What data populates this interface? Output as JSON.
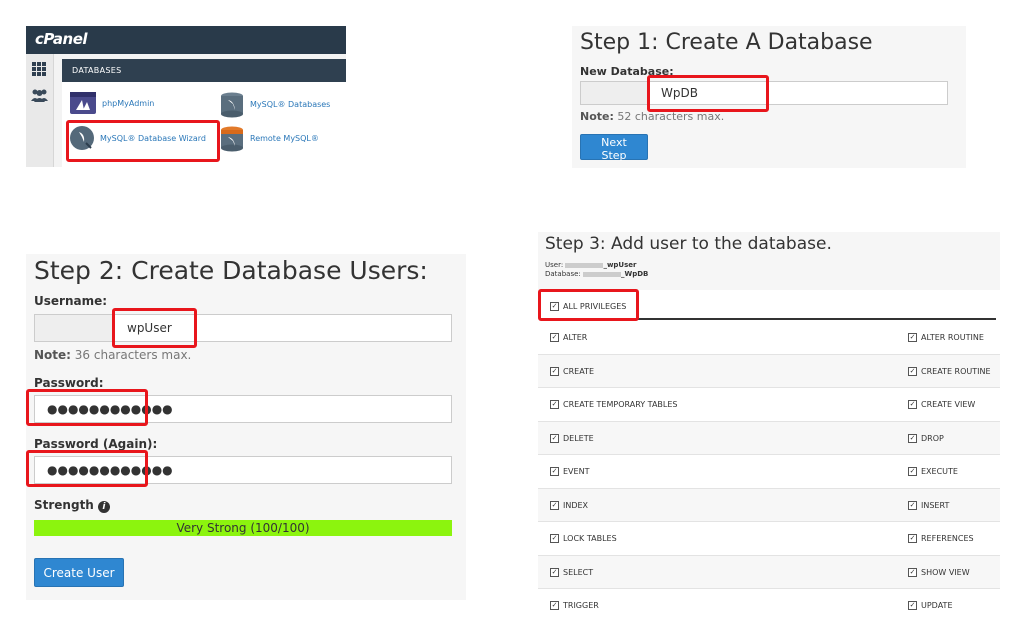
{
  "cpanel": {
    "logo": "cPanel",
    "section_header": "DATABASES",
    "items": [
      {
        "label": "phpMyAdmin",
        "icon": "phpmyadmin-icon"
      },
      {
        "label": "MySQL® Databases",
        "icon": "mysql-databases-icon"
      },
      {
        "label": "MySQL® Database Wizard",
        "icon": "database-wizard-icon"
      },
      {
        "label": "Remote MySQL®",
        "icon": "remote-mysql-icon"
      }
    ],
    "sidebar_icons": [
      "grid-icon",
      "users-icon"
    ]
  },
  "step1": {
    "title": "Step 1: Create A Database",
    "label": "New Database:",
    "value": "WpDB",
    "note_bold": "Note:",
    "note": " 52 characters max.",
    "button": "Next Step"
  },
  "step2": {
    "title": "Step 2: Create Database Users:",
    "username_label": "Username:",
    "username": "wpUser",
    "note_bold": "Note:",
    "note": " 36 characters max.",
    "password_label": "Password:",
    "password": "●●●●●●●●●●●●",
    "password_again_label": "Password (Again):",
    "password_again": "●●●●●●●●●●●●",
    "strength_label": "Strength",
    "strength_text": "Very Strong (100/100)",
    "strength_value": 100,
    "button": "Create User"
  },
  "step3": {
    "title": "Step 3: Add user to the database.",
    "user_label": "User:",
    "user_suffix": "_wpUser",
    "database_label": "Database:",
    "database_suffix": "_WpDB",
    "all_privileges": "ALL PRIVILEGES",
    "rows": [
      {
        "left": "ALTER",
        "right": "ALTER ROUTINE"
      },
      {
        "left": "CREATE",
        "right": "CREATE ROUTINE"
      },
      {
        "left": "CREATE TEMPORARY TABLES",
        "right": "CREATE VIEW"
      },
      {
        "left": "DELETE",
        "right": "DROP"
      },
      {
        "left": "EVENT",
        "right": "EXECUTE"
      },
      {
        "left": "INDEX",
        "right": "INSERT"
      },
      {
        "left": "LOCK TABLES",
        "right": "REFERENCES"
      },
      {
        "left": "SELECT",
        "right": "SHOW VIEW"
      },
      {
        "left": "TRIGGER",
        "right": "UPDATE"
      }
    ]
  },
  "colors": {
    "highlight": "#e8161c",
    "button": "#2f87d1",
    "strength_bar": "#8cf40e",
    "cpanel_header": "#293a4a"
  }
}
